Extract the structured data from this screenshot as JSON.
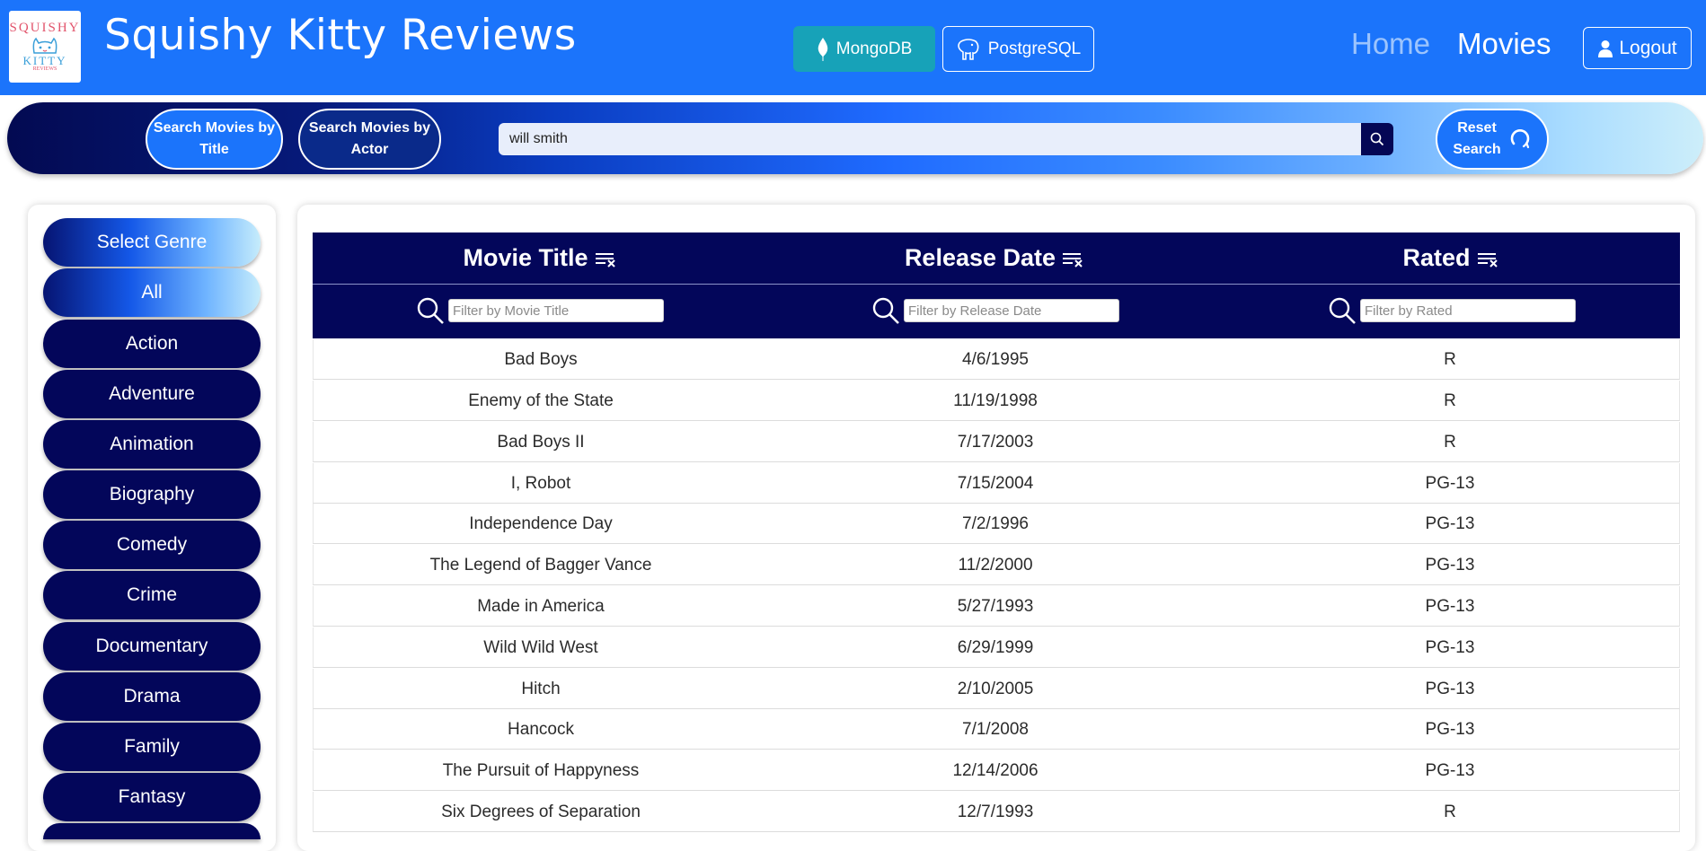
{
  "header": {
    "logo": {
      "line1": "SQUISHY",
      "line2": "KITTY",
      "line3": "REVIEWS"
    },
    "title": "Squishy Kitty Reviews",
    "db_buttons": {
      "mongo": "MongoDB",
      "postgres": "PostgreSQL"
    },
    "nav": {
      "home": "Home",
      "movies": "Movies"
    },
    "logout": "Logout"
  },
  "search": {
    "by_title": [
      "Search Movies by",
      "Title"
    ],
    "by_actor": [
      "Search Movies by",
      "Actor"
    ],
    "query": "will smith",
    "reset": [
      "Reset",
      "Search"
    ]
  },
  "sidebar": {
    "items": [
      "Select Genre",
      "All",
      "Action",
      "Adventure",
      "Animation",
      "Biography",
      "Comedy",
      "Crime",
      "Documentary",
      "Drama",
      "Family",
      "Fantasy",
      ""
    ]
  },
  "table": {
    "columns": [
      "Movie Title",
      "Release Date",
      "Rated"
    ],
    "filters": [
      "Filter by Movie Title",
      "Filter by Release Date",
      "Filter by Rated"
    ],
    "rows": [
      [
        "Bad Boys",
        "4/6/1995",
        "R"
      ],
      [
        "Enemy of the State",
        "11/19/1998",
        "R"
      ],
      [
        "Bad Boys II",
        "7/17/2003",
        "R"
      ],
      [
        "I, Robot",
        "7/15/2004",
        "PG-13"
      ],
      [
        "Independence Day",
        "7/2/1996",
        "PG-13"
      ],
      [
        "The Legend of Bagger Vance",
        "11/2/2000",
        "PG-13"
      ],
      [
        "Made in America",
        "5/27/1993",
        "PG-13"
      ],
      [
        "Wild Wild West",
        "6/29/1999",
        "PG-13"
      ],
      [
        "Hitch",
        "2/10/2005",
        "PG-13"
      ],
      [
        "Hancock",
        "7/1/2008",
        "PG-13"
      ],
      [
        "The Pursuit of Happyness",
        "12/14/2006",
        "PG-13"
      ],
      [
        "Six Degrees of Separation",
        "12/7/1993",
        "R"
      ]
    ]
  },
  "colors": {
    "header_blue": "#1b74fb",
    "navy": "#03065a",
    "mongo_teal": "#17a2b8",
    "home_link": "#9cc4fd"
  },
  "icons": [
    "mongodb-leaf-icon",
    "postgresql-elephant-icon",
    "user-icon",
    "search-icon",
    "reset-icon",
    "clear-sort-icon",
    "filter-search-icon"
  ]
}
